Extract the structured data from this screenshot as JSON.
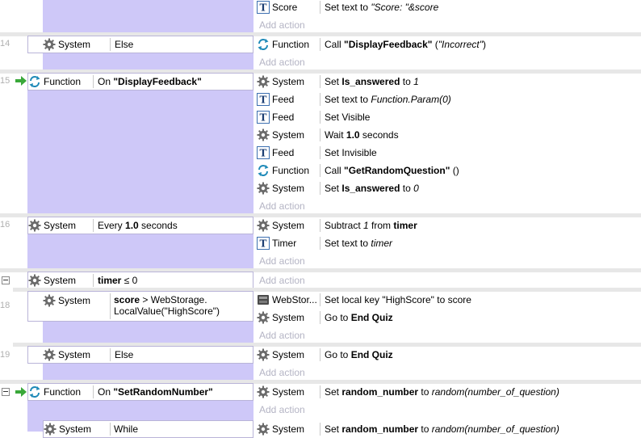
{
  "events": {
    "score_text": {
      "object": "Score",
      "pre": "Set text to ",
      "italic": "\"Score: \"&score"
    },
    "add_action": "Add action",
    "e14": {
      "num": "14",
      "cond_object": "System",
      "cond_text": "Else",
      "action_object": "Function",
      "action_pre": "Call ",
      "action_bold": "\"DisplayFeedback\"",
      "action_post": " (",
      "action_italic": "\"Incorrect\"",
      "action_end": ")"
    },
    "e15": {
      "num": "15",
      "cond_object": "Function",
      "cond_pre": "On ",
      "cond_bold": "\"DisplayFeedback\"",
      "actions": [
        {
          "object": "System",
          "pre": "Set ",
          "bold": "Is_answered",
          "mid": " to ",
          "italic": "1"
        },
        {
          "object": "Feed",
          "pre": "Set text to ",
          "italic": "Function.Param(0)"
        },
        {
          "object": "Feed",
          "pre": "Set Visible"
        },
        {
          "object": "System",
          "pre": "Wait ",
          "bold": "1.0",
          "mid": " seconds"
        },
        {
          "object": "Feed",
          "pre": "Set Invisible"
        },
        {
          "object": "Function",
          "pre": "Call ",
          "bold": "\"GetRandomQuestion\"",
          "mid": " ()"
        },
        {
          "object": "System",
          "pre": "Set ",
          "bold": "Is_answered",
          "mid": " to ",
          "italic": "0"
        }
      ]
    },
    "e16": {
      "num": "16",
      "cond_object": "System",
      "cond_pre": "Every ",
      "cond_bold": "1.0",
      "cond_post": " seconds",
      "actions": [
        {
          "object": "System",
          "pre": "Subtract ",
          "italic": "1",
          "mid": " from ",
          "bold": "timer"
        },
        {
          "object": "Timer",
          "pre": "Set text to ",
          "italic": "timer"
        }
      ]
    },
    "e17": {
      "cond_object": "System",
      "cond_bold": "timer",
      "cond_post": " ≤ 0"
    },
    "e18": {
      "num": "18",
      "cond_object": "System",
      "cond_bold": "score",
      "cond_line1": " > WebStorage.",
      "cond_line2": "LocalValue(\"HighScore\")",
      "actions": [
        {
          "object": "WebStor...",
          "pre": "Set local key \"HighScore\" to score"
        },
        {
          "object": "System",
          "pre": "Go to ",
          "bold": "End Quiz"
        }
      ]
    },
    "e19": {
      "num": "19",
      "cond_object": "System",
      "cond_text": "Else",
      "action_object": "System",
      "action_pre": "Go to ",
      "action_bold": "End Quiz"
    },
    "e20": {
      "cond_object": "Function",
      "cond_pre": "On ",
      "cond_bold": "\"SetRandomNumber\"",
      "action_object": "System",
      "action_pre": "Set ",
      "action_bold": "random_number",
      "action_mid": " to ",
      "action_italic": "random(number_of_question)"
    },
    "e21": {
      "cond_object": "System",
      "cond_text": "While",
      "action_object": "System",
      "action_pre": "Set ",
      "action_bold": "random_number",
      "action_mid": " to ",
      "action_italic": "random(number_of_question)"
    }
  }
}
